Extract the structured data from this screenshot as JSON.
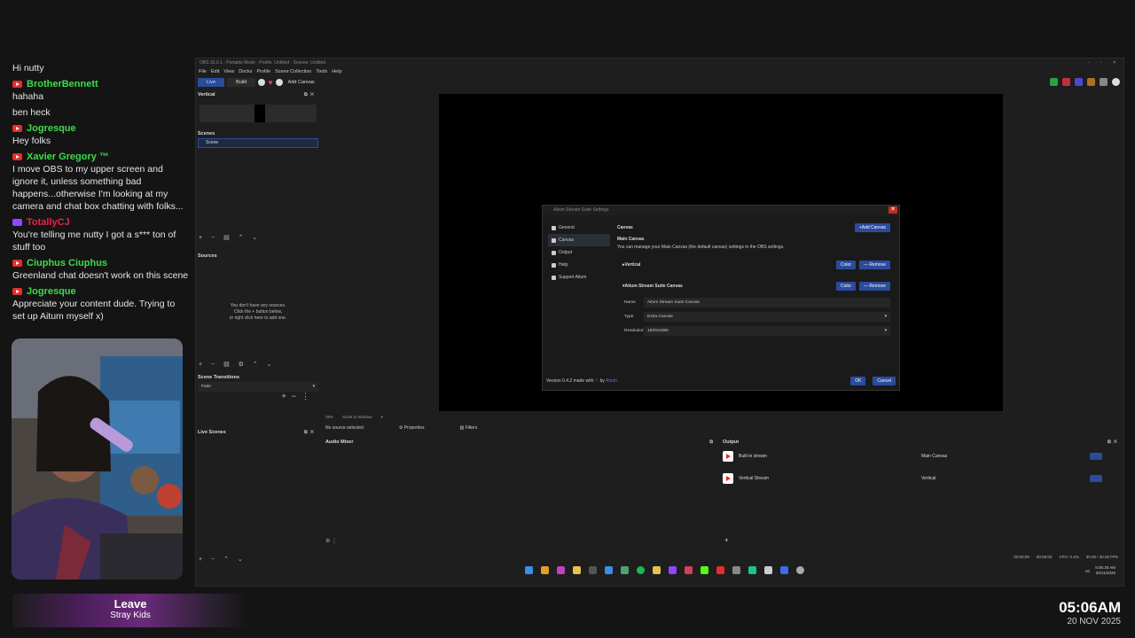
{
  "chat": {
    "messages": [
      {
        "platform": "none",
        "user": "",
        "text": "Hi nutty"
      },
      {
        "platform": "youtube",
        "user": "BrotherBennett",
        "color": "#3ddc4a",
        "text": "hahaha"
      },
      {
        "platform": "none",
        "user": "",
        "text": "ben heck"
      },
      {
        "platform": "youtube",
        "user": "Jogresque",
        "color": "#3ddc4a",
        "text": "Hey folks"
      },
      {
        "platform": "youtube",
        "user": "Xavier Gregory ™",
        "color": "#3ddc4a",
        "text": "I move OBS to my upper screen and ignore it, unless something bad happens...otherwise I'm looking at my camera and chat box chatting with folks..."
      },
      {
        "platform": "twitch",
        "user": "TotallyCJ",
        "color": "#e0264a",
        "text": "You're telling me nutty I got a s*** ton of stuff too"
      },
      {
        "platform": "youtube",
        "user": "Ciuphus Ciuphus",
        "color": "#3ddc4a",
        "text": "Greenland chat doesn't work on this scene"
      },
      {
        "platform": "youtube",
        "user": "Jogresque",
        "color": "#3ddc4a",
        "text": "Appreciate your content dude. Trying to set up Aitum myself x)"
      }
    ]
  },
  "music": {
    "song": "Leave",
    "artist": "Stray Kids"
  },
  "clock": {
    "time": "05:06AM",
    "date": "20 NOV 2025"
  },
  "obs": {
    "title": "OBS 32.0.1 - Portable Mode - Profile: Untitled - Scenes: Untitled",
    "menu": [
      "File",
      "Edit",
      "View",
      "Docks",
      "Profile",
      "Scene Collection",
      "Tools",
      "Help"
    ],
    "tabs": {
      "live": "Live",
      "build": "Build"
    },
    "add_canvas": "Add Canvas",
    "vertical_dock": "Vertical",
    "scenes_title": "Scenes",
    "scene_item": "Scene",
    "sources_title": "Sources",
    "sources_empty": "You don't have any sources.\nClick the + button below,\nor right click here to add one.",
    "transitions_title": "Scene Transitions",
    "transition": "Fade",
    "live_scenes_title": "Live Scenes",
    "zoom": "35%",
    "scale_mode": "Scale to Window",
    "no_source": "No source selected",
    "properties": "Properties",
    "filters": "Filters",
    "mixer_title": "Audio Mixer",
    "output_title": "Output",
    "outputs": [
      {
        "name": "Built-in stream",
        "canvas": "Main Canvas"
      },
      {
        "name": "Vertical Stream",
        "canvas": "Vertical"
      }
    ],
    "status": {
      "t1": "00:00:00",
      "t2": "00:00:00",
      "cpu": "CPU: 0.4%",
      "fps": "30.00 / 30.00 FPS"
    }
  },
  "settings": {
    "title": "Aitum Stream Suite Settings",
    "nav": [
      "General",
      "Canvas",
      "Output",
      "Help",
      "Support Aitum"
    ],
    "heading": "Canvas",
    "add_button": "Add Canvas",
    "main_title": "Main Canvas",
    "main_desc": "You can manage your Main Canvas (the default canvas) settings in the OBS settings.",
    "canvases": [
      {
        "name": "Vertical",
        "color": "Color",
        "remove": "Remove"
      },
      {
        "name": "Aitum Stream Suite Canvas",
        "color": "Color",
        "remove": "Remove"
      }
    ],
    "fields": {
      "name_label": "Name",
      "name_value": "Aitum Stream Suite Canvas",
      "type_label": "Type",
      "type_value": "Extra Canvas",
      "res_label": "Resolution",
      "res_value": "1920x1080"
    },
    "version": "Version 0.4.2 made with ♡ by",
    "version_link": "Aitum",
    "ok": "OK",
    "cancel": "Cancel"
  },
  "taskbar": {
    "time": "5:06:28 AM",
    "date": "20/11/2025",
    "battery": "61"
  }
}
